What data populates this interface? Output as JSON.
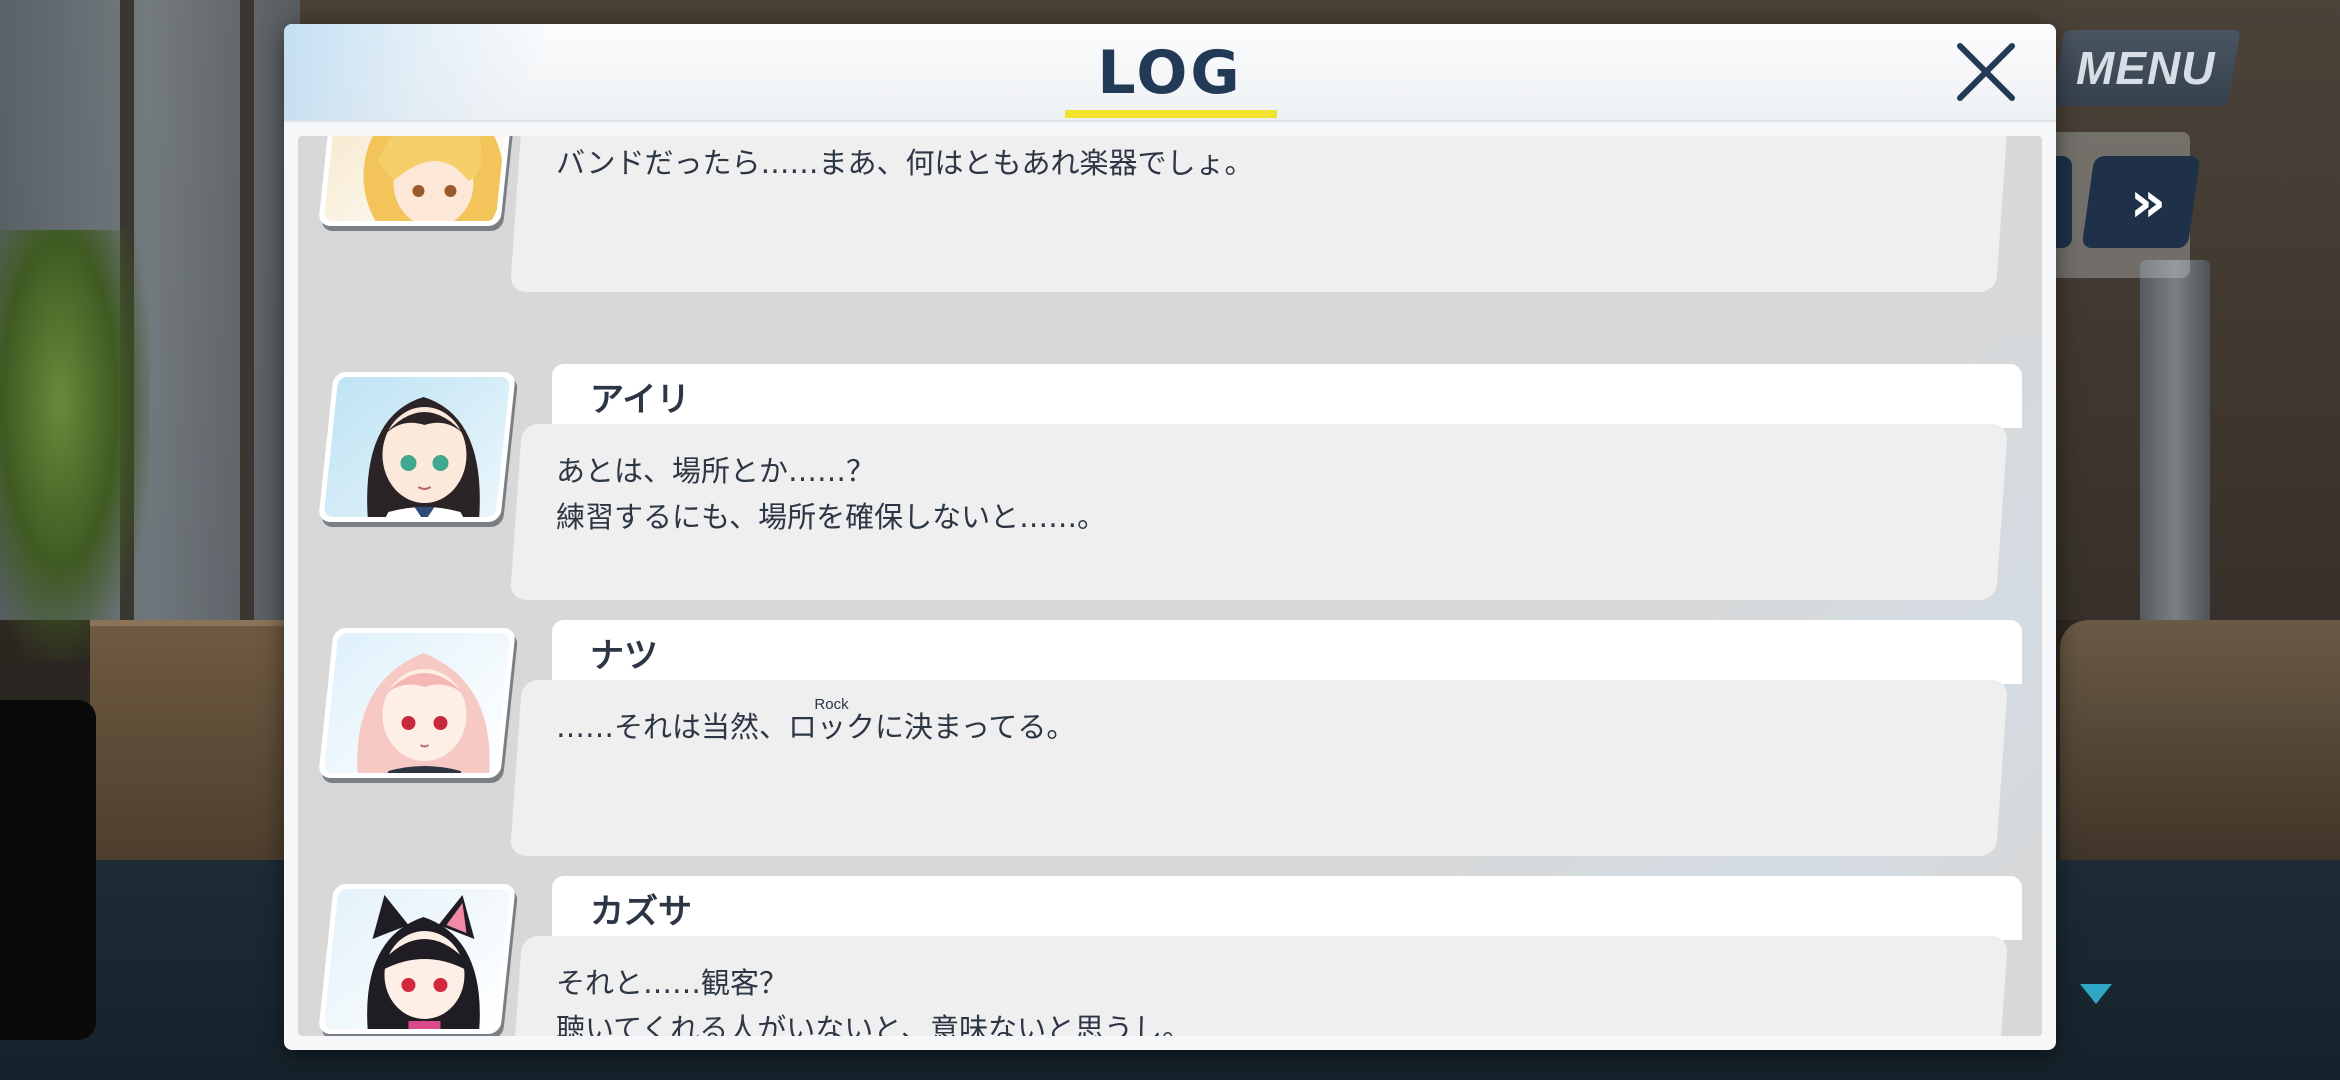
{
  "log": {
    "title": "LOG",
    "close_icon": "close-icon"
  },
  "menu": {
    "label": "MENU"
  },
  "controls": {
    "fast_forward_icon": "fast-forward-icon",
    "fast_forward_glyph": "»",
    "scroll_indicator_icon": "triangle-down-icon"
  },
  "colors": {
    "title": "#233a57",
    "underline": "#f2e22e",
    "button_dark": "#1e3148"
  },
  "entries": [
    {
      "speaker": "",
      "portrait_icon": "character-portrait-blonde",
      "lines": [
        "バンドだったら……まあ、何はともあれ楽器でしょ。"
      ]
    },
    {
      "speaker": "アイリ",
      "portrait_icon": "character-portrait-airi",
      "lines": [
        "あとは、場所とか……？",
        "練習するにも、場所を確保しないと……。"
      ]
    },
    {
      "speaker": "ナツ",
      "portrait_icon": "character-portrait-natsu",
      "line_before_ruby": "……それは当然、",
      "ruby_base": "ロック",
      "ruby_text": "Rock",
      "line_after_ruby": "に決まってる。"
    },
    {
      "speaker": "カズサ",
      "portrait_icon": "character-portrait-kazusa",
      "lines": [
        "それと……観客？",
        "聴いてくれる人がいないと、意味ないと思うし。"
      ]
    }
  ]
}
